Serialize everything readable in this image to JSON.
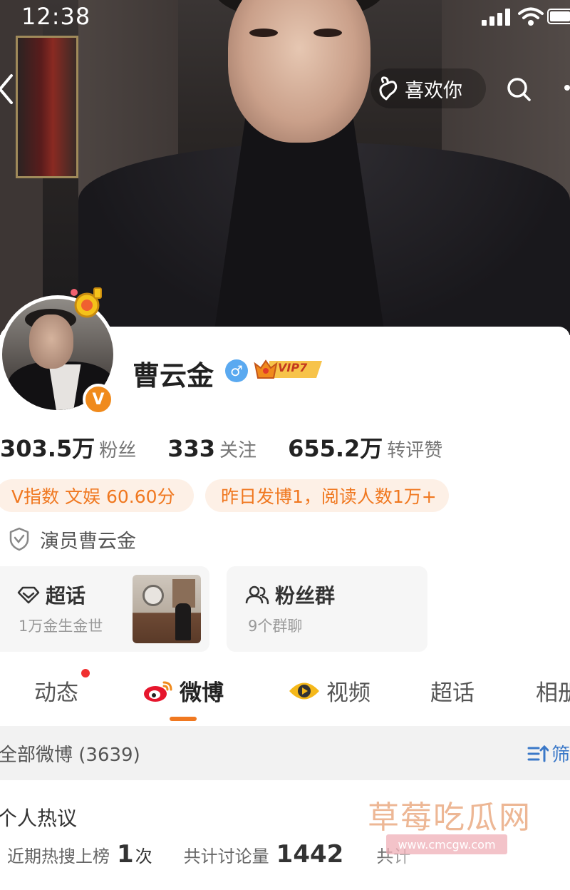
{
  "status_bar": {
    "time": "12:38"
  },
  "header": {
    "like_label": "喜欢你"
  },
  "profile": {
    "name": "曹云金",
    "vip_label": "VIP7",
    "verified_badge": "V",
    "gender_symbol": "♂",
    "stats": [
      {
        "value": "303.5万",
        "label": "粉丝"
      },
      {
        "value": "333",
        "label": "关注"
      },
      {
        "value": "655.2万",
        "label": "转评赞"
      }
    ],
    "pills": [
      "V指数 文娱 60.60分",
      "昨日发博1，阅读人数1万+"
    ],
    "verified_text": "演员曹云金"
  },
  "cards": [
    {
      "title": "超话",
      "subtitle": "1万金生金世"
    },
    {
      "title": "粉丝群",
      "subtitle": "9个群聊"
    }
  ],
  "tabs": [
    {
      "label": "动态",
      "has_dot": true
    },
    {
      "label": "微博",
      "active": true
    },
    {
      "label": "视频"
    },
    {
      "label": "超话"
    },
    {
      "label": "相册"
    }
  ],
  "feed_filter": {
    "label": "全部微博 (3639)",
    "filter_button": "筛选"
  },
  "hot_discussion": {
    "title": "个人热议",
    "items": [
      {
        "label": "近期热搜上榜",
        "value": "1",
        "unit": "次"
      },
      {
        "label": "共计讨论量",
        "value": "1442",
        "unit": ""
      },
      {
        "label": "共计",
        "value": "",
        "unit": ""
      }
    ]
  },
  "watermark": {
    "text": "草莓吃瓜网",
    "url": "www.cmcgw.com"
  },
  "colors": {
    "accent": "#f07820",
    "pill_bg": "#fdf0e6",
    "link": "#3a78c8",
    "gender": "#5aa9f0"
  }
}
